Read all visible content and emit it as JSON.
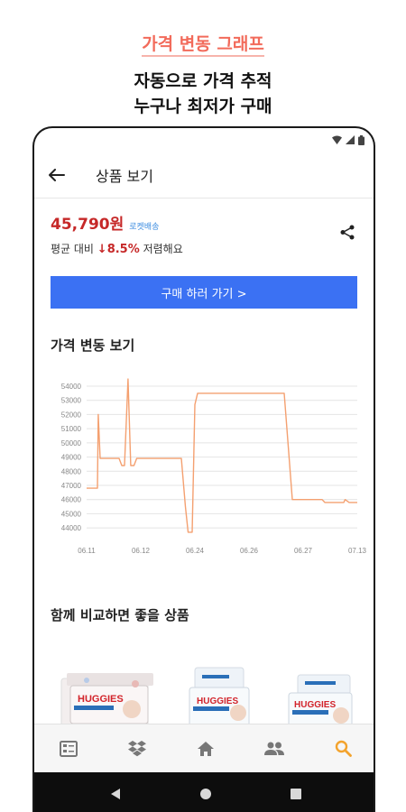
{
  "promo": {
    "tag": "가격 변동 그래프",
    "headline_line1": "자동으로 가격 추적",
    "headline_line2": "누구나 최저가 구매"
  },
  "appbar": {
    "title": "상품 보기"
  },
  "product": {
    "price": "45,790원",
    "badge": "로켓배송",
    "compare_prefix": "평균 대비 ",
    "compare_arrow": "↓",
    "compare_percent": "8.5%",
    "compare_suffix": " 저렴해요"
  },
  "buy_button": {
    "label": "구매 하러 가기 >"
  },
  "price_chart_section": {
    "title": "가격 변동 보기"
  },
  "recommend_section": {
    "title": "함께 비교하면 좋을 상품"
  },
  "product_thumbnails": [
    {
      "brand": "HUGGIES"
    },
    {
      "brand": "HUGGIES"
    },
    {
      "brand": "HUGGIES"
    }
  ],
  "colors": {
    "accent_blue": "#3b71f3",
    "price_red": "#c62828",
    "promo_coral": "#f26b5b",
    "chart_line": "#f4a070",
    "active_tab": "#f3a32d",
    "inactive_tab": "#7a7a7a"
  },
  "tabs": [
    {
      "icon": "list-icon",
      "active": false
    },
    {
      "icon": "dropbox-icon",
      "active": false
    },
    {
      "icon": "home-icon",
      "active": false
    },
    {
      "icon": "people-icon",
      "active": false
    },
    {
      "icon": "search-icon",
      "active": true
    }
  ],
  "chart_data": {
    "type": "line",
    "title": "",
    "xlabel": "",
    "ylabel": "",
    "x_tick_labels": [
      "06.11",
      "06.12",
      "06.24",
      "06.26",
      "06.27",
      "07.13"
    ],
    "y_ticks": [
      44000,
      45000,
      46000,
      47000,
      48000,
      49000,
      50000,
      51000,
      52000,
      53000,
      54000
    ],
    "ylim": [
      43500,
      54700
    ],
    "xlim": [
      0,
      100
    ],
    "grid": true,
    "legend": "none",
    "series": [
      {
        "points": [
          [
            0,
            46800
          ],
          [
            4,
            46800
          ],
          [
            4.3,
            52000
          ],
          [
            5,
            48900
          ],
          [
            9,
            48900
          ],
          [
            12,
            48900
          ],
          [
            13,
            48400
          ],
          [
            14,
            48400
          ],
          [
            15.3,
            54500
          ],
          [
            16.3,
            48400
          ],
          [
            17.5,
            48400
          ],
          [
            18.5,
            48900
          ],
          [
            35,
            48900
          ],
          [
            36.5,
            45500
          ],
          [
            37.5,
            43700
          ],
          [
            39,
            43700
          ],
          [
            40,
            52700
          ],
          [
            41,
            53500
          ],
          [
            73,
            53500
          ],
          [
            76,
            46000
          ],
          [
            87,
            46000
          ],
          [
            88,
            45800
          ],
          [
            95,
            45800
          ],
          [
            95.5,
            46000
          ],
          [
            97,
            45800
          ],
          [
            100,
            45800
          ]
        ]
      }
    ]
  }
}
